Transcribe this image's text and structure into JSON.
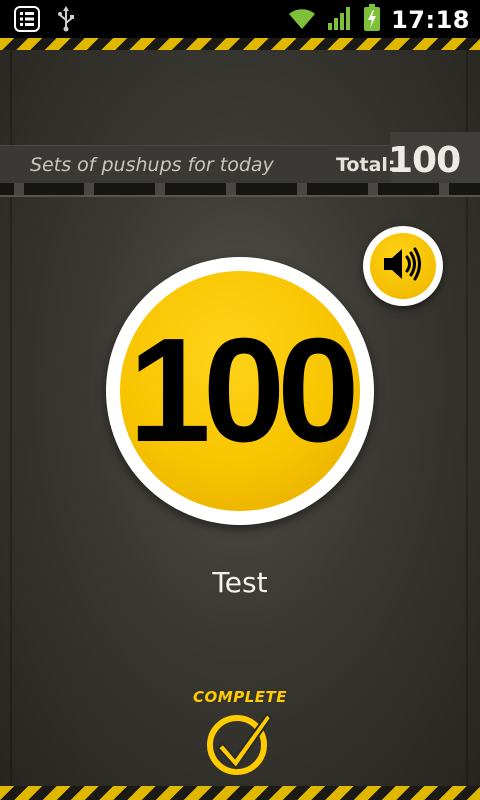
{
  "status_bar": {
    "time": "17:18",
    "icons": [
      "notification-icon",
      "usb-icon",
      "wifi-icon",
      "signal-icon",
      "battery-charging-icon"
    ]
  },
  "header": {
    "title": "Sets of pushups for today",
    "total_label": "Total:",
    "total_value": "100"
  },
  "counter": {
    "value": "100"
  },
  "exercise": {
    "name": "Test"
  },
  "actions": {
    "complete_label": "COMPLETE"
  },
  "colors": {
    "accent_yellow": "#f8c400",
    "background": "#2a2926",
    "status_bar": "#000000"
  }
}
